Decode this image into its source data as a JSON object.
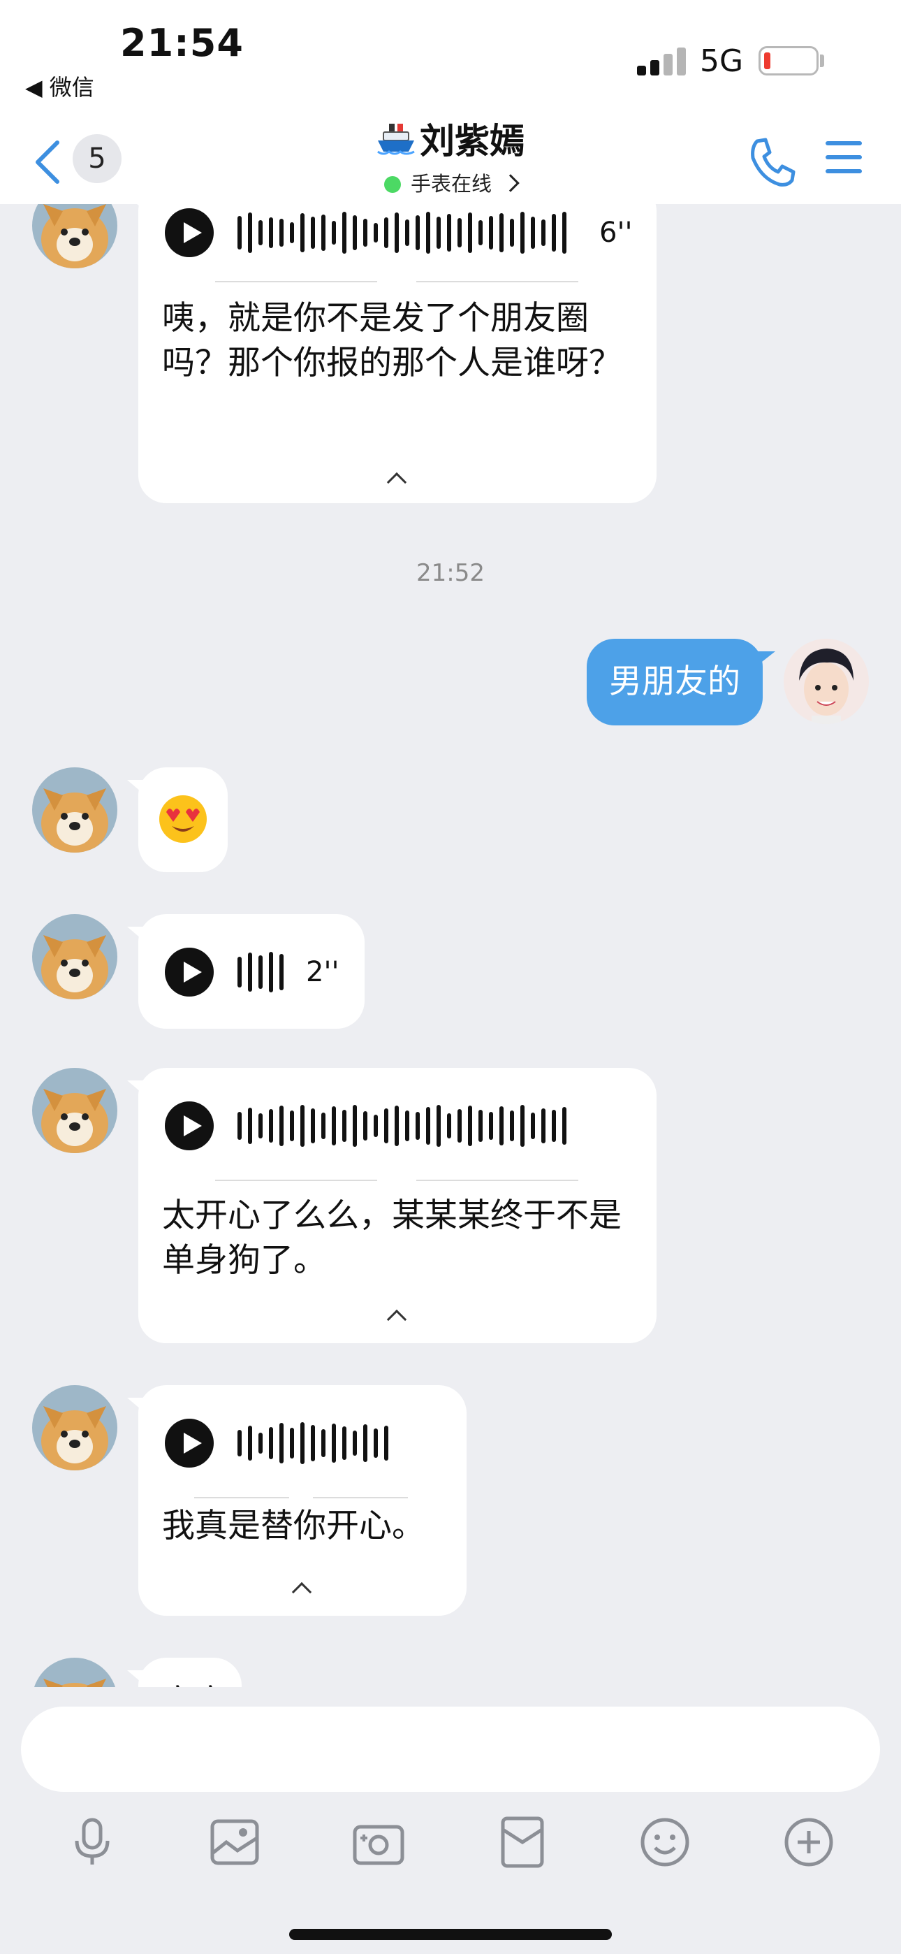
{
  "status_bar": {
    "time": "21:54",
    "back_app": "◀ 微信",
    "network": "5G"
  },
  "nav": {
    "unread_count": "5",
    "title": "刘紫嫣",
    "subtitle": "手表在线"
  },
  "messages": {
    "m1": {
      "duration": "6''",
      "transcript": "咦，就是你不是发了个朋友圈吗？那个你报的那个人是谁呀？"
    },
    "timestamp": "21:52",
    "m2": {
      "text": "男朋友的"
    },
    "m3": {
      "emoji": "🤩"
    },
    "m4": {
      "duration": "2''"
    },
    "m5": {
      "transcript": "太开心了么么，某某某终于不是单身狗了。"
    },
    "m6": {
      "transcript": "我真是替你开心。"
    },
    "m7": {
      "partial_text": "亲亲"
    }
  },
  "input": {
    "placeholder": ""
  },
  "toolbar": {
    "icons": [
      "microphone-icon",
      "image-icon",
      "camera-icon",
      "red-packet-icon",
      "emoji-icon",
      "plus-icon"
    ]
  },
  "colors": {
    "accent": "#3d8fe0",
    "sent_bubble": "#4da1e8",
    "background": "#edeef2",
    "online": "#4cd964",
    "battery_low": "#ee3b30"
  }
}
